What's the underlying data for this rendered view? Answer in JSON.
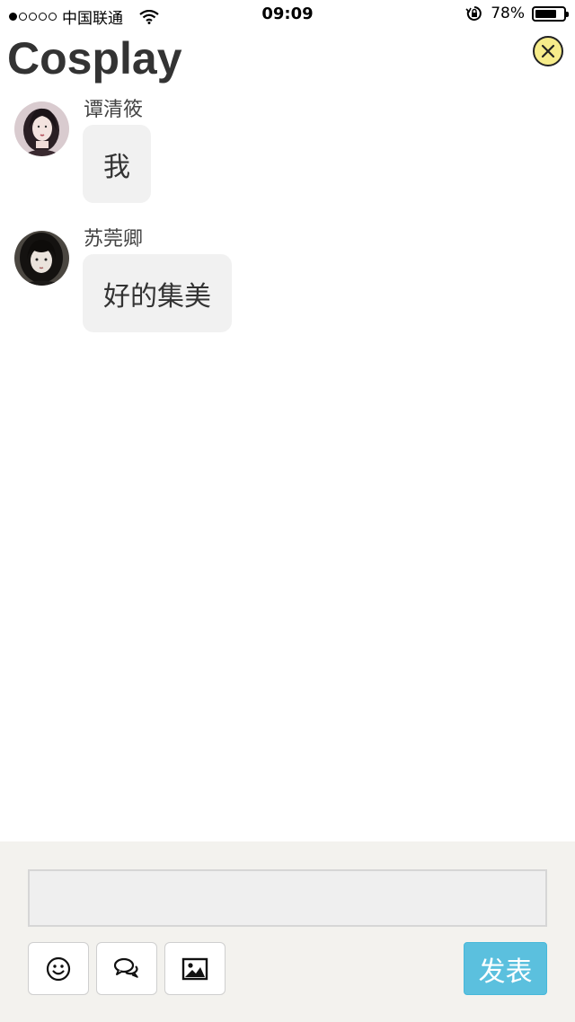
{
  "status_bar": {
    "carrier": "中国联通",
    "time": "09:09",
    "battery_percent": "78%",
    "battery_level": 0.78,
    "signal_bars_filled": 1,
    "signal_bars_total": 5
  },
  "header": {
    "title": "Cosplay",
    "close_icon": "close-circle-icon",
    "close_color": "#f6ec8a"
  },
  "messages": [
    {
      "sender": "谭清筱",
      "text": "我"
    },
    {
      "sender": "苏莞卿",
      "text": "好的集美"
    }
  ],
  "composer": {
    "input_value": "",
    "input_placeholder": "",
    "tools": [
      "smiley-icon",
      "chat-bubbles-icon",
      "image-icon"
    ],
    "send_label": "发表",
    "send_color": "#5bc0de"
  }
}
